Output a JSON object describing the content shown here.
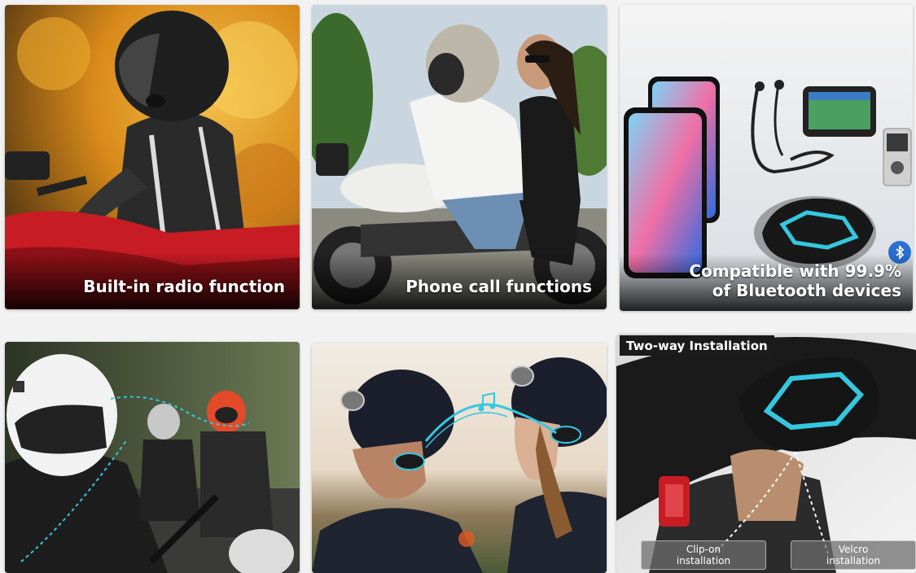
{
  "tiles": [
    {
      "caption": "Built-in radio function"
    },
    {
      "caption": "Phone call functions"
    },
    {
      "caption_line1": "Compatible with 99.9%",
      "caption_line2": "of Bluetooth devices"
    },
    {},
    {},
    {
      "banner": "Two-way Installation",
      "option1_line1": "Clip-on",
      "option1_line2": "installation",
      "option2_line1": "Velcro",
      "option2_line2": "installation"
    }
  ],
  "colors": {
    "accent_cyan": "#35c7e0",
    "autumn_orange": "#d98a1a",
    "moto_red": "#c81c24"
  },
  "icons": [
    "bluetooth-icon",
    "music-note-icon",
    "gps-device-icon",
    "earphones-icon"
  ]
}
